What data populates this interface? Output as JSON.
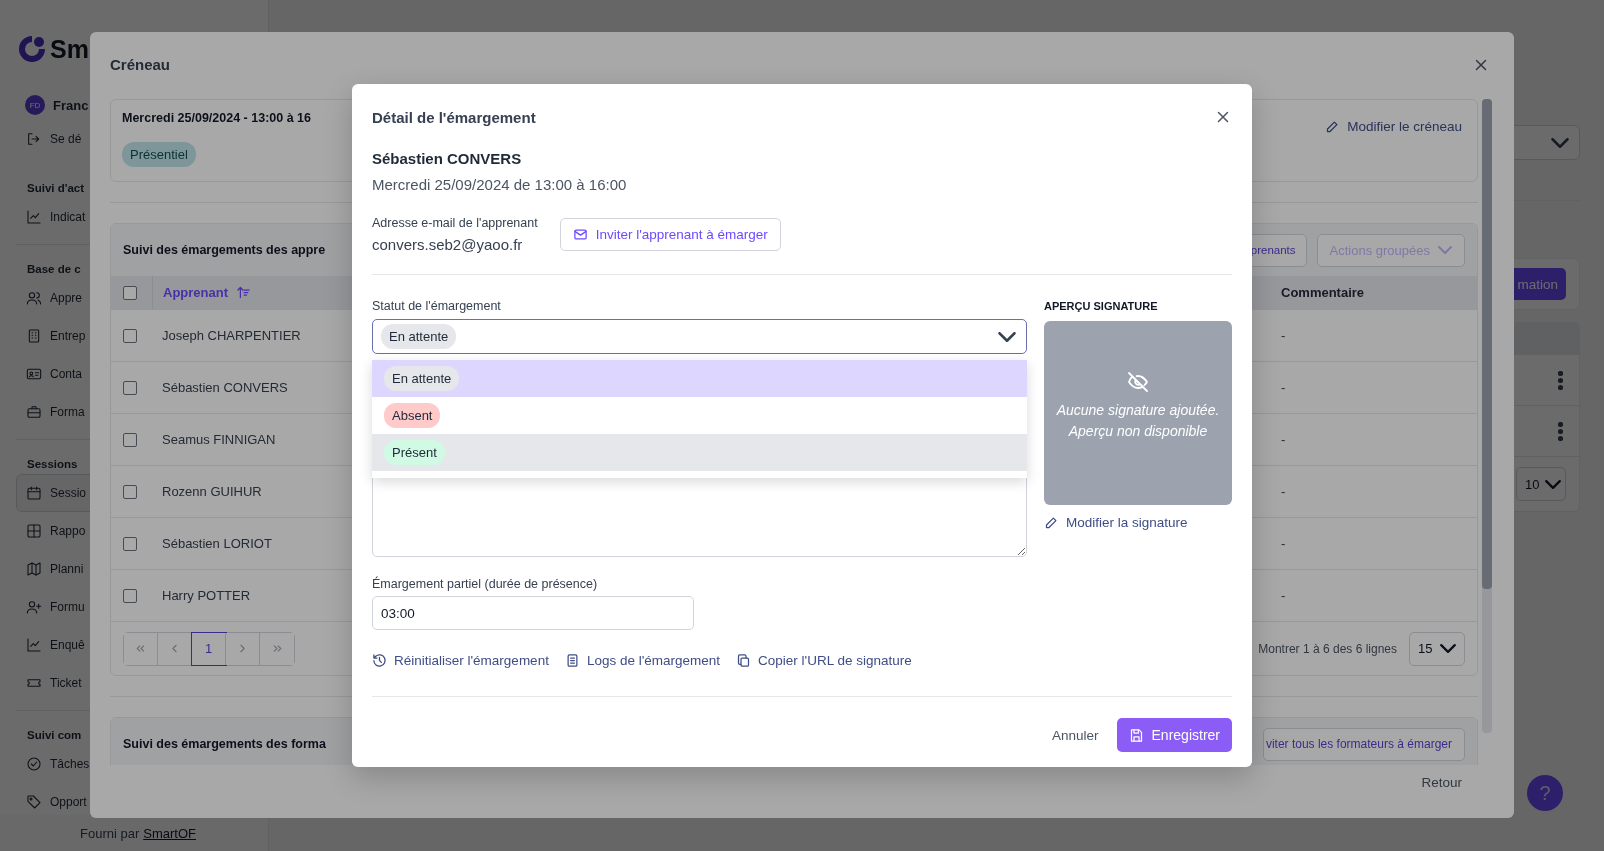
{
  "app": {
    "logo_text": "Sm",
    "user": {
      "initials": "FD",
      "name": "Franc"
    },
    "logout": "Se dé",
    "sidebar_sections": [
      {
        "title": "Suivi d'act",
        "items": [
          {
            "label": "Indicat",
            "selected": false
          }
        ]
      },
      {
        "title": "Base de c",
        "items": [
          {
            "label": "Appre",
            "selected": false
          },
          {
            "label": "Entrep",
            "selected": false
          },
          {
            "label": "Conta",
            "selected": false
          },
          {
            "label": "Forma",
            "selected": false
          }
        ]
      },
      {
        "title": "Sessions",
        "items": [
          {
            "label": "Sessio",
            "selected": true
          },
          {
            "label": "Rappo",
            "selected": false
          },
          {
            "label": "Planni",
            "selected": false
          },
          {
            "label": "Formu",
            "selected": false
          },
          {
            "label": "Enquê",
            "selected": false
          },
          {
            "label": "Ticket",
            "selected": false
          }
        ]
      },
      {
        "title": "Suivi com",
        "items": [
          {
            "label": "Tâches",
            "selected": false
          },
          {
            "label": "Opport",
            "selected": false
          }
        ]
      }
    ],
    "footer": {
      "prefix": "Fourni par",
      "link": "SmartOF"
    },
    "main": {
      "create_button": "mation",
      "page_size": "10",
      "help_button": "?"
    }
  },
  "creneau": {
    "title": "Créneau",
    "slot": {
      "title": "Mercredi 25/09/2024 - 13:00 à 16",
      "badge": "Présentiel",
      "edit_link": "Modifier le créneau"
    },
    "learners_section": {
      "title": "Suivi des émargements des appre",
      "invite_button": "prenants",
      "group_actions": {
        "label": "Actions groupées",
        "disabled": true
      },
      "columns": [
        "Apprenant",
        "Commentaire"
      ],
      "select_all_checked": false,
      "rows": [
        {
          "name": "Joseph CHARPENTIER",
          "comment": "-",
          "checked": false
        },
        {
          "name": "Sébastien CONVERS",
          "comment": "-",
          "checked": false
        },
        {
          "name": "Seamus FINNIGAN",
          "comment": "-",
          "checked": false
        },
        {
          "name": "Rozenn GUIHUR",
          "comment": "-",
          "checked": false
        },
        {
          "name": "Sébastien LORIOT",
          "comment": "-",
          "checked": false
        },
        {
          "name": "Harry POTTER",
          "comment": "-",
          "checked": false
        }
      ],
      "pages": [
        {
          "label": "1",
          "selected": true
        }
      ],
      "summary": "Montrer 1 à 6 des 6 lignes",
      "page_size": "15"
    },
    "trainers_section": {
      "title": "Suivi des émargements des forma",
      "invite_button": "viter tous les formateurs à émarger"
    },
    "back_button": "Retour"
  },
  "detail": {
    "title": "Détail de l'émargement",
    "learner": "Sébastien CONVERS",
    "when": "Mercredi 25/09/2024 de 13:00 à 16:00",
    "email_label": "Adresse e-mail de l'apprenant",
    "email": "convers.seb2@yaoo.fr",
    "invite_button": "Inviter l'apprenant à émarger",
    "status": {
      "label": "Statut de l'émargement",
      "value": "En attente",
      "expanded": true,
      "options": [
        {
          "label": "En attente",
          "color": "#e5e7eb",
          "selected": true,
          "hovered": false
        },
        {
          "label": "Absent",
          "color": "#fecaca",
          "selected": false,
          "hovered": false
        },
        {
          "label": "Présent",
          "color": "#d1fae5",
          "selected": false,
          "hovered": true
        }
      ]
    },
    "signature": {
      "label": "APERÇU SIGNATURE",
      "empty_text": "Aucune signature ajoutée. Aperçu non disponible",
      "edit_link": "Modifier la signature"
    },
    "partial": {
      "label": "Émargement partiel (durée de présence)",
      "value": "03:00"
    },
    "actions": [
      "Réinitialiser l'émargement",
      "Logs de l'émargement",
      "Copier l'URL de signature"
    ],
    "cancel_button": "Annuler",
    "save_button": "Enregistrer"
  }
}
